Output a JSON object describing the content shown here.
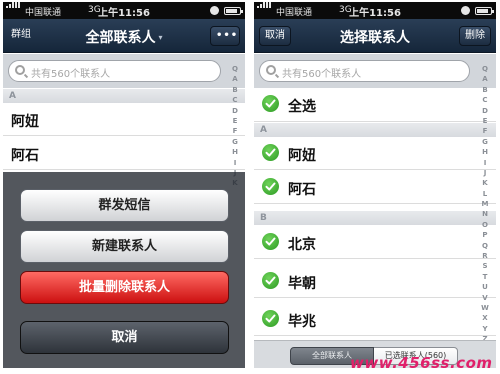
{
  "left": {
    "status": {
      "carrier": "中国联通",
      "network": "3G",
      "time": "上午11:56"
    },
    "nav": {
      "left_button": "群组",
      "title": "全部联系人",
      "caret": "▾",
      "more": "•••"
    },
    "search": {
      "placeholder": "共有560个联系人"
    },
    "sections": [
      {
        "header": "A",
        "rows": [
          "阿妞",
          "阿石"
        ]
      }
    ],
    "index": [
      "Q",
      "A",
      "B",
      "C",
      "D",
      "E",
      "F",
      "G",
      "H",
      "I",
      "J",
      "K"
    ],
    "action_sheet": {
      "group_sms": "群发短信",
      "new_contact": "新建联系人",
      "batch_delete": "批量删除联系人",
      "cancel": "取消"
    }
  },
  "right": {
    "status": {
      "carrier": "中国联通",
      "network": "3G",
      "time": "上午11:56"
    },
    "nav": {
      "left_button": "取消",
      "title": "选择联系人",
      "right_button": "删除"
    },
    "search": {
      "placeholder": "共有560个联系人"
    },
    "select_all": "全选",
    "sections": [
      {
        "header": "A",
        "rows": [
          "阿妞",
          "阿石"
        ]
      },
      {
        "header": "B",
        "rows": [
          "北京",
          "毕朝",
          "毕兆"
        ]
      }
    ],
    "index": [
      "Q",
      "A",
      "B",
      "C",
      "D",
      "E",
      "F",
      "G",
      "H",
      "I",
      "J",
      "K",
      "L",
      "M",
      "N",
      "O",
      "P",
      "Q",
      "R",
      "S",
      "T",
      "U",
      "V",
      "W",
      "X",
      "Y",
      "Z",
      "#"
    ],
    "toolbar": {
      "all_contacts": "全部联系人",
      "selected_contacts": "已选联系人(560)"
    }
  },
  "watermark": "www.456ss.com"
}
